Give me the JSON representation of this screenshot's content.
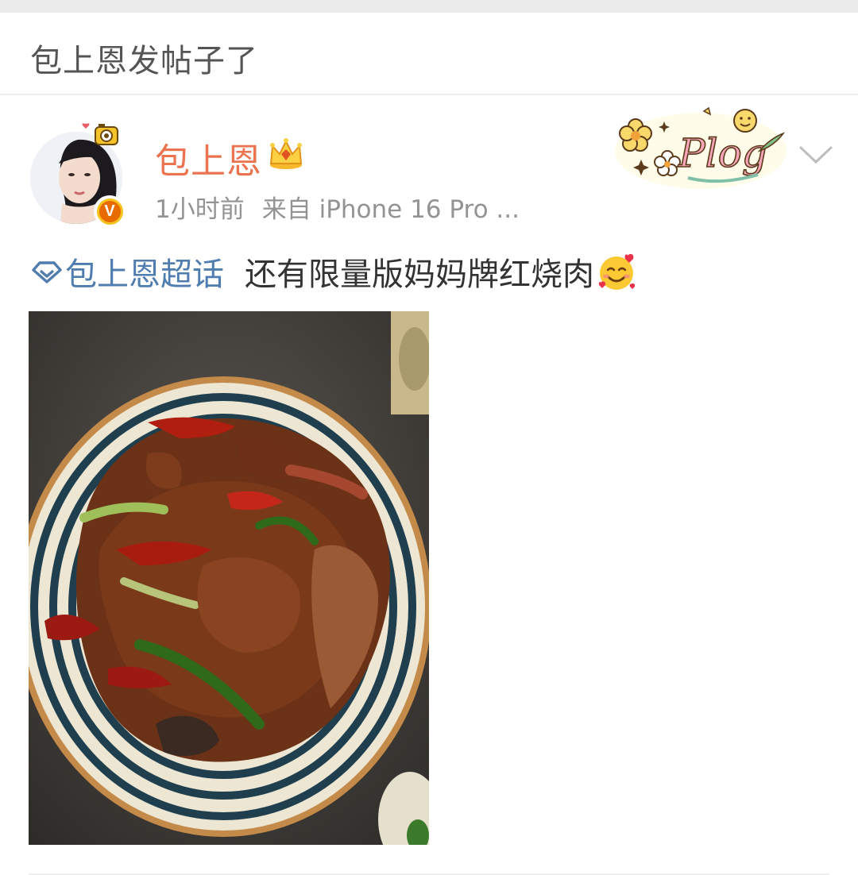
{
  "header": {
    "title": "包上恩发帖子了"
  },
  "post": {
    "author": {
      "name": "包上恩",
      "verified_badge": "V"
    },
    "meta": {
      "time": "1小时前",
      "source": "来自 iPhone 16 Pro ..."
    },
    "sticker": {
      "text": "Plog"
    },
    "content": {
      "topic": "包上恩超话",
      "text": "还有限量版妈妈牌红烧肉"
    },
    "icons": {
      "crown": "crown-icon",
      "chevron": "chevron-down-icon",
      "topic": "diamond-topic-icon",
      "emoji": "smiling-face-with-hearts-icon"
    },
    "colors": {
      "username": "#eb7350",
      "topic_link": "#507daf",
      "meta": "#939393",
      "verified": "#e86b00"
    }
  }
}
